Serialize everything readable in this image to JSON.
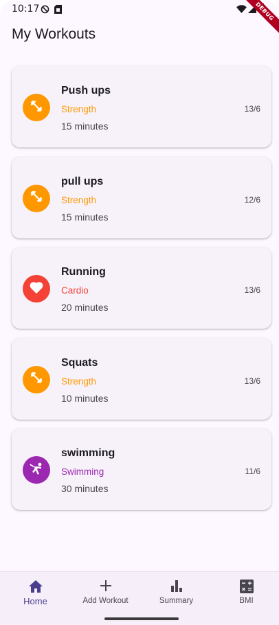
{
  "status_bar": {
    "time": "10:17",
    "debug_label": "DEBUG"
  },
  "app_bar": {
    "title": "My Workouts"
  },
  "workouts": [
    {
      "name": "Push ups",
      "category": "Strength",
      "duration": "15 minutes",
      "date": "13/6",
      "color": "#ff9800",
      "icon": "fitness-center-icon"
    },
    {
      "name": "pull ups",
      "category": "Strength",
      "duration": "15 minutes",
      "date": "12/6",
      "color": "#ff9800",
      "icon": "fitness-center-icon"
    },
    {
      "name": "Running",
      "category": "Cardio",
      "duration": "20 minutes",
      "date": "13/6",
      "color": "#f44336",
      "icon": "heart-icon"
    },
    {
      "name": "Squats",
      "category": "Strength",
      "duration": "10 minutes",
      "date": "13/6",
      "color": "#ff9800",
      "icon": "fitness-center-icon"
    },
    {
      "name": "swimming",
      "category": "Swimming",
      "duration": "30 minutes",
      "date": "11/6",
      "color": "#9c27b0",
      "icon": "swimmer-icon"
    }
  ],
  "bottom_nav": {
    "items": [
      {
        "label": "Home",
        "icon": "home-icon",
        "active": true
      },
      {
        "label": "Add Workout",
        "icon": "plus-icon",
        "active": false
      },
      {
        "label": "Summary",
        "icon": "bar-chart-icon",
        "active": false
      },
      {
        "label": "BMI",
        "icon": "calculator-icon",
        "active": false
      }
    ]
  },
  "colors": {
    "accent": "#4a3f8f",
    "strength": "#ff9800",
    "cardio": "#f44336",
    "swimming": "#9c27b0"
  }
}
